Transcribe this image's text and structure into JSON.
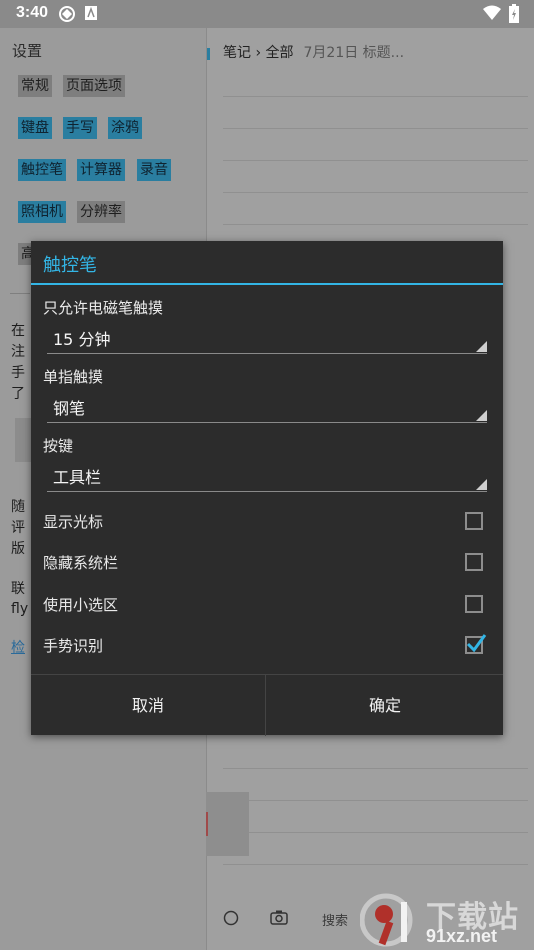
{
  "status_bar": {
    "time": "3:40",
    "icons": [
      "app-icon-1",
      "app-icon-2",
      "wifi-icon",
      "battery-icon"
    ]
  },
  "settings_panel": {
    "title": "设置",
    "chips": [
      {
        "label": "常规",
        "active": false
      },
      {
        "label": "页面选项",
        "active": false
      },
      {
        "label": "键盘",
        "active": true
      },
      {
        "label": "手写",
        "active": true
      },
      {
        "label": "涂鸦",
        "active": true
      },
      {
        "label": "触控笔",
        "active": true
      },
      {
        "label": "计算器",
        "active": true
      },
      {
        "label": "录音",
        "active": true
      },
      {
        "label": "照相机",
        "active": true
      },
      {
        "label": "分辨率",
        "active": false
      },
      {
        "label": "高",
        "active": false
      }
    ],
    "partial_text": [
      "在",
      "注",
      "手",
      "了",
      "随",
      "评",
      "版",
      "联",
      "fly",
      "检"
    ]
  },
  "notes_panel": {
    "breadcrumb": "笔记 › 全部",
    "search_hint": "7月21日 标题...",
    "bottom_search": "搜索"
  },
  "dialog": {
    "title": "触控笔",
    "stylus_only_label": "只允许电磁笔触摸",
    "stylus_only_value": "15 分钟",
    "single_finger_label": "单指触摸",
    "single_finger_value": "钢笔",
    "key_label": "按键",
    "key_value": "工具栏",
    "checkboxes": [
      {
        "label": "显示光标",
        "checked": false
      },
      {
        "label": "隐藏系统栏",
        "checked": false
      },
      {
        "label": "使用小选区",
        "checked": false
      },
      {
        "label": "手势识别",
        "checked": true
      }
    ],
    "cancel_label": "取消",
    "ok_label": "确定"
  },
  "watermark": {
    "big": "下载站",
    "small": "91xz.net"
  },
  "colors": {
    "accent": "#33b5e5",
    "dialog_bg": "#2c2c2c",
    "overlay_bg": "#9a9a9a"
  }
}
